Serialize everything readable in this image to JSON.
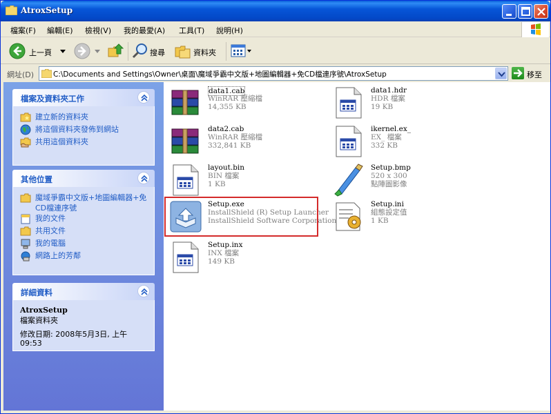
{
  "window": {
    "title": "AtroxSetup"
  },
  "menu": [
    "檔案(F)",
    "編輯(E)",
    "檢視(V)",
    "我的最愛(A)",
    "工具(T)",
    "說明(H)"
  ],
  "toolbar": {
    "back": "上一頁",
    "search": "搜尋",
    "folders": "資料夾"
  },
  "address": {
    "label": "網址(D)",
    "path": "C:\\Documents and Settings\\Owner\\桌面\\魔域爭霸中文版+地圖編輯器+免CD檔連序號\\AtroxSetup",
    "go": "移至"
  },
  "tasks_panel": {
    "title": "檔案及資料夾工作",
    "items": [
      "建立新的資料夾",
      "將這個資料夾發佈到網站",
      "共用這個資料夾"
    ]
  },
  "places_panel": {
    "title": "其他位置",
    "items": [
      "魔域爭霸中文版+地圖編輯器+免CD檔連序號",
      "我的文件",
      "共用文件",
      "我的電腦",
      "網路上的芳鄰"
    ]
  },
  "details_panel": {
    "title": "詳細資料",
    "name": "AtroxSetup",
    "type": "檔案資料夾",
    "modified": "修改日期: 2008年5月3日, 上午 09:53"
  },
  "files": [
    {
      "name": "data1.cab",
      "line1": "WinRAR 壓縮檔",
      "line2": "14,355 KB",
      "icon": "winrar-icon"
    },
    {
      "name": "data1.hdr",
      "line1": "HDR 檔案",
      "line2": "19 KB",
      "icon": "generic-file-icon"
    },
    {
      "name": "data2.cab",
      "line1": "WinRAR 壓縮檔",
      "line2": "332,841 KB",
      "icon": "winrar-icon"
    },
    {
      "name": "ikernel.ex_",
      "line1": "EX_ 檔案",
      "line2": "332 KB",
      "icon": "generic-file-icon"
    },
    {
      "name": "layout.bin",
      "line1": "BIN 檔案",
      "line2": "1 KB",
      "icon": "generic-file-icon"
    },
    {
      "name": "Setup.bmp",
      "line1": "520 x 300",
      "line2": "點陣圖影像",
      "icon": "paint-icon"
    },
    {
      "name": "Setup.exe",
      "line1": "InstallShield (R) Setup Launcher",
      "line2": "InstallShield Software Corporation",
      "icon": "installshield-icon"
    },
    {
      "name": "Setup.ini",
      "line1": "組態設定值",
      "line2": "1 KB",
      "icon": "ini-settings-icon"
    },
    {
      "name": "Setup.inx",
      "line1": "INX 檔案",
      "line2": "149 KB",
      "icon": "generic-file-icon"
    }
  ]
}
